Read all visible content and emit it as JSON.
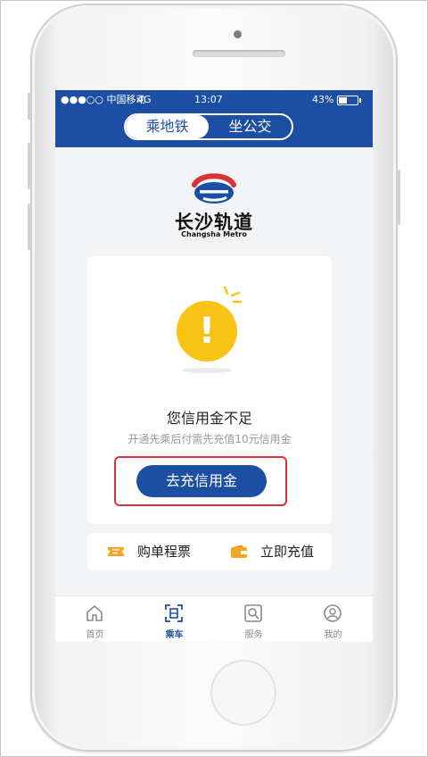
{
  "status_bar": {
    "carrier": "●●●○○ 中国移动",
    "network": "4G",
    "time": "13:07",
    "battery": "43%"
  },
  "segmented_control": {
    "options": [
      "乘地铁",
      "坐公交"
    ],
    "selected": "乘地铁"
  },
  "brand": {
    "name_cn": "长沙轨道",
    "name_en": "Changsha Metro"
  },
  "notice": {
    "title": "您信用金不足",
    "description": "开通先乘后付需先充值10元信用金",
    "button_label": "去充信用金"
  },
  "quick_actions": [
    {
      "label": "购单程票",
      "icon": "ticket-icon"
    },
    {
      "label": "立即充值",
      "icon": "wallet-icon"
    }
  ],
  "tab_bar": [
    {
      "label": "首页",
      "icon": "home-icon"
    },
    {
      "label": "乘车",
      "icon": "qr-scan-icon",
      "active": true
    },
    {
      "label": "服务",
      "icon": "service-search-icon"
    },
    {
      "label": "我的",
      "icon": "user-icon"
    }
  ],
  "colors": {
    "primary": "#1c4fa3",
    "warning": "#f9c316",
    "highlight_border": "#d9323a",
    "action_icon": "#f5a623"
  }
}
